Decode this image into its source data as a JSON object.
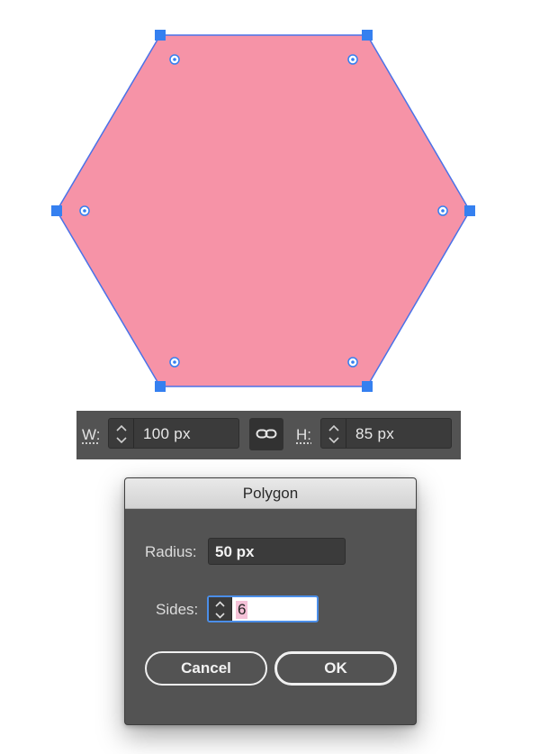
{
  "shape": {
    "fill": "#f693a7",
    "stroke": "#4a72e8",
    "handle_color": "#3580f0"
  },
  "control_bar": {
    "width_label": "W:",
    "width_value": "100 px",
    "height_label": "H:",
    "height_value": "85 px"
  },
  "dialog": {
    "title": "Polygon",
    "radius_label": "Radius:",
    "radius_value": "50 px",
    "sides_label": "Sides:",
    "sides_value": "6",
    "cancel_label": "Cancel",
    "ok_label": "OK"
  }
}
